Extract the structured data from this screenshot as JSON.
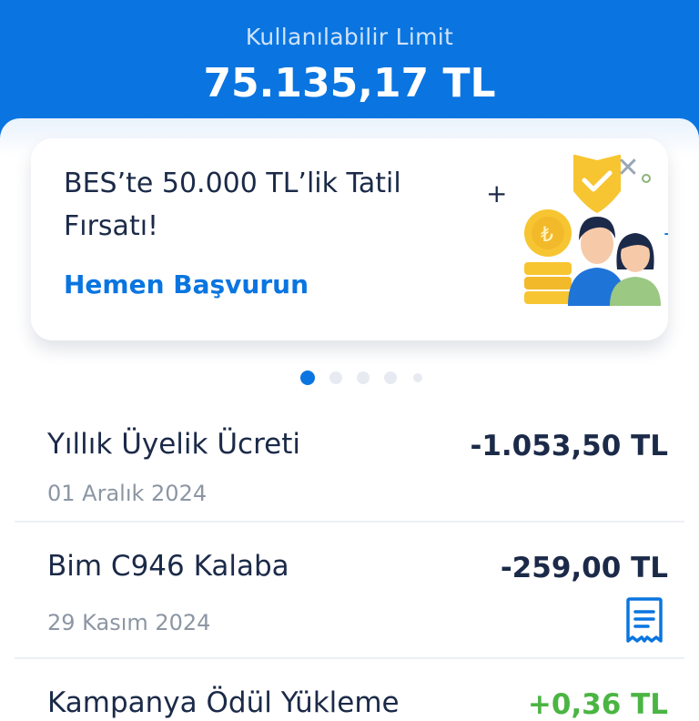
{
  "header": {
    "limit_label": "Kullanılabilir Limit",
    "limit_value": "75.135,17 TL"
  },
  "promo": {
    "title": "BES’te 50.000 TL’lik Tatil Fırsatı!",
    "cta": "Hemen Başvurun",
    "close_icon": "close-icon",
    "illustration": "family-savings-illustration"
  },
  "carousel": {
    "total": 5,
    "active_index": 0
  },
  "transactions": [
    {
      "title": "Yıllık Üyelik Ücreti",
      "amount": "-1.053,50 TL",
      "date": "01 Aralık 2024",
      "has_receipt": false
    },
    {
      "title": "Bim C946 Kalaba",
      "amount": "-259,00 TL",
      "date": "29 Kasım 2024",
      "has_receipt": true,
      "receipt_icon": "receipt-icon"
    },
    {
      "title": "Kampanya Ödül Yükleme",
      "amount": "+0,36 TL",
      "date": "",
      "has_receipt": false
    }
  ],
  "colors": {
    "brand_blue": "#0a75e0",
    "positive_green": "#4bb543",
    "text_dark": "#1b2a48",
    "text_muted": "#8c96a3"
  }
}
